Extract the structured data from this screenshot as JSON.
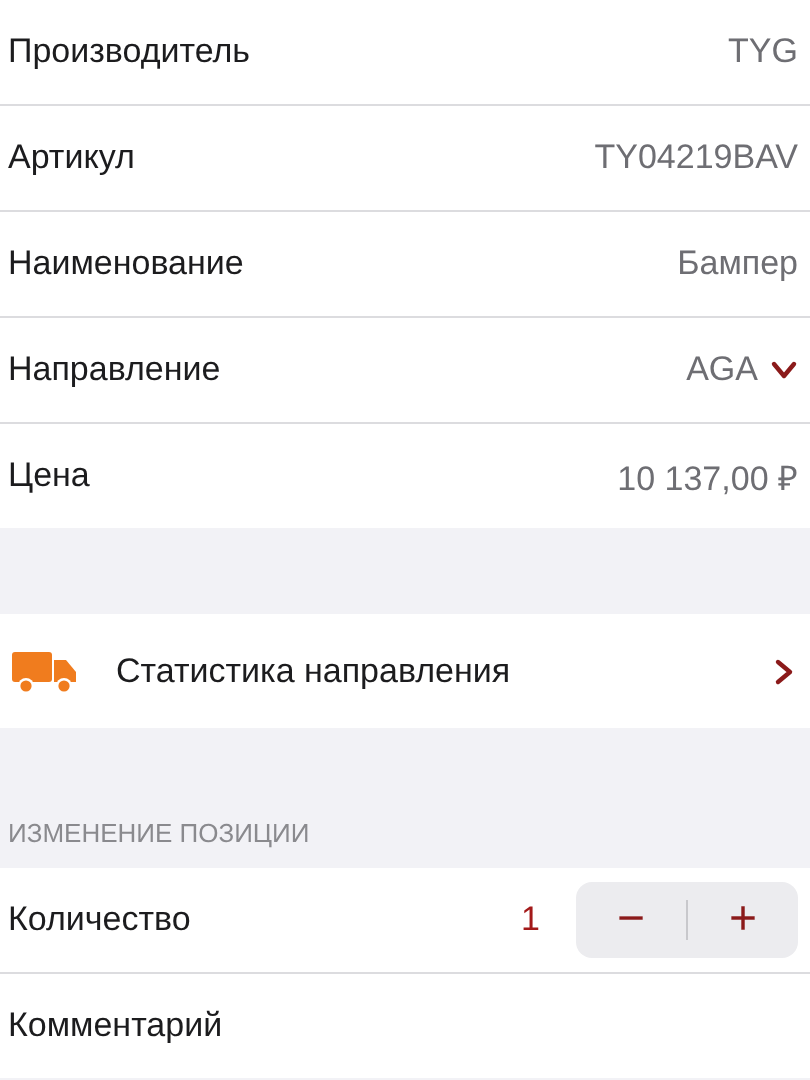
{
  "details": [
    {
      "kind": "text",
      "label": "Производитель",
      "value": "TYG"
    },
    {
      "kind": "text",
      "label": "Артикул",
      "value": "TY04219BAV"
    },
    {
      "kind": "text",
      "label": "Наименование",
      "value": "Бампер"
    },
    {
      "kind": "dropdown",
      "label": "Направление",
      "value": "AGA"
    },
    {
      "kind": "text",
      "label": "Цена",
      "value": "10 137,00 ₽"
    }
  ],
  "stats": {
    "label": "Статистика направления"
  },
  "edit_section": {
    "header": "ИЗМЕНЕНИЕ ПОЗИЦИИ",
    "quantity": {
      "label": "Количество",
      "value": "1",
      "minus": "−",
      "plus": "+"
    },
    "comment": {
      "label": "Комментарий"
    }
  }
}
